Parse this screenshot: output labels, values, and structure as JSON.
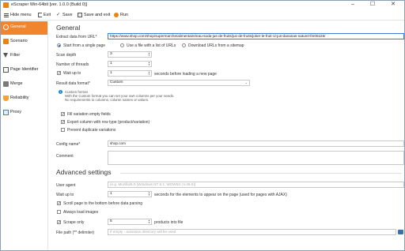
{
  "title": "eScraper Win-64bit [ver. 1.0.0 (Build 0)]",
  "toolbar": {
    "hide_menu": "Hide menu",
    "exit": "Exit",
    "save": "Save",
    "save_exit": "Save and exit",
    "run": "Run"
  },
  "sidebar": [
    {
      "label": "General",
      "icon": "gear-icon",
      "active": true
    },
    {
      "label": "Scenario",
      "icon": "scenario-icon"
    },
    {
      "label": "Filter",
      "icon": "filter-icon"
    },
    {
      "label": "Page Identifier",
      "icon": "page-icon"
    },
    {
      "label": "Merge",
      "icon": "merge-icon"
    },
    {
      "label": "Reliability",
      "icon": "shield-icon"
    },
    {
      "label": "Proxy",
      "icon": "proxy-icon"
    }
  ],
  "general": {
    "heading": "General",
    "extract_label": "Extract data from URL*",
    "extract_url": "https://www.shop.com/shop/supermarche/alimentaire/eau-soda-jus-de-fruits/jus-de-fruits/joker-le-fruit-1l-jus-dananas-naturel-fm00226/",
    "radio_single": "Start from a single page",
    "radio_file": "Use a file with a list of URLs",
    "radio_sitemap": "Download URLs from a sitemap",
    "scan_depth_label": "Scan depth",
    "scan_depth": "3",
    "threads_label": "Number of threads",
    "threads": "1",
    "wait_label": "Wait up to",
    "wait_value": "1",
    "wait_suffix": "seconds before loading a new page",
    "format_label": "Result data format*",
    "format_value": "Custom",
    "custom_title": "Custom format",
    "custom_desc1": "With the Custom format you can set your own columns per your needs.",
    "custom_desc2": "No requirements to columns, column names or values.",
    "fill_empty": "Fill variation empty fields",
    "export_row": "Export column with row type (product/variation)",
    "prevent_dup": "Prevent duplicate variations",
    "config_label": "Config name*",
    "config_value": "shop.com",
    "comment_label": "Comment"
  },
  "advanced": {
    "heading": "Advanced settings",
    "ua_label": "User agent",
    "ua_placeholder": "(e.g. Mozilla/5.0 (Windows NT 6.1; WOW64; rv:46.0))",
    "wait_label": "Wait up to",
    "wait_value": "1",
    "wait_suffix": "seconds for the elements to appear on the page (used for pages with AJAX)",
    "scroll": "Scroll page to the bottom before data parsing",
    "always_images": "Always load images",
    "scrape_only": "Scrape only",
    "scrape_value": "5",
    "scrape_suffix": "products into file",
    "file_path_label": "File path (** delimiter)",
    "file_path_placeholder": "If empty - autosave directory will be used"
  }
}
